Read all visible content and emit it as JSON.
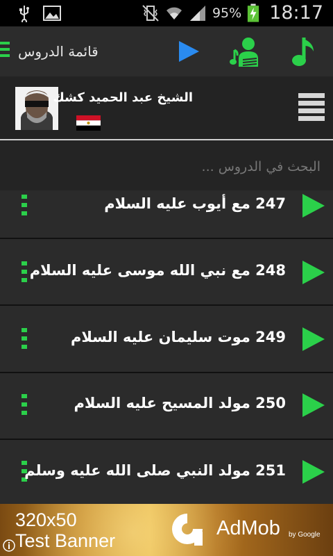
{
  "status_bar": {
    "icons_left": [
      "usb-icon",
      "image-icon"
    ],
    "icons_right": [
      "vibrate-icon",
      "wifi-icon",
      "signal-icon",
      "battery-charging-icon"
    ],
    "battery_percent": "95%",
    "time": "18:17"
  },
  "toolbar": {
    "title": "قائمة الدروس",
    "icons": [
      "menu-icon",
      "play-icon",
      "sheikh-music-icon",
      "music-note-icon"
    ]
  },
  "header": {
    "sheikh_name": "الشيخ عبد الحميد كشك",
    "flag": "egypt-flag"
  },
  "search": {
    "placeholder": "البحث في الدروس ..."
  },
  "lessons": [
    {
      "number": "247",
      "title": "مع أيوب عليه السلام"
    },
    {
      "number": "248",
      "title": "مع نبي الله موسى عليه السلام"
    },
    {
      "number": "249",
      "title": "موت سليمان عليه السلام"
    },
    {
      "number": "250",
      "title": "مولد المسيح عليه السلام"
    },
    {
      "number": "251",
      "title": "مولد النبي صلى الله عليه وسلم"
    }
  ],
  "ad": {
    "size": "320x50",
    "text": "Test Banner",
    "brand": "AdMob",
    "by": "by Google"
  },
  "colors": {
    "accent": "#2bd04a",
    "play_blue": "#2a8bf0",
    "background": "#2b2b2b"
  }
}
